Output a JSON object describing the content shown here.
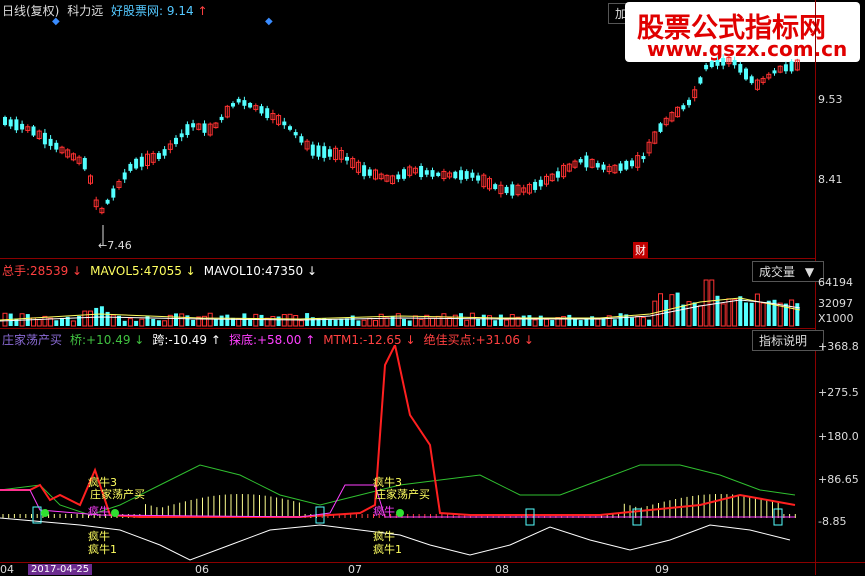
{
  "header": {
    "period": "日线(复权)",
    "stock": "科力远",
    "indicator": "好股票网:",
    "indicator_value": "9.14",
    "arrow_up": "↑",
    "add_button": "加自"
  },
  "watermark": {
    "line1": "股票公式指标网",
    "line2": "www.gszx.com.cn"
  },
  "price_panel": {
    "y_labels": [
      "9.53",
      "8.41"
    ],
    "low_marker": "←7.46",
    "cai_badge": "财"
  },
  "volume_panel": {
    "items": [
      {
        "label": "总手:",
        "value": "28539",
        "arrow": "↓",
        "color": "#ff4040"
      },
      {
        "label": "MAVOL5:",
        "value": "47055",
        "arrow": "↓",
        "color": "#ffff60"
      },
      {
        "label": "MAVOL10:",
        "value": "47350",
        "arrow": "↓",
        "color": "#ffffff"
      }
    ],
    "dropdown_label": "成交量",
    "y_labels": [
      "64194",
      "32097",
      "X1000"
    ]
  },
  "indicator_panel": {
    "items": [
      {
        "label": "庄家荡产买",
        "value": "",
        "arrow": "",
        "color": "#8b6bd6"
      },
      {
        "label": "桥:",
        "value": "+10.49",
        "arrow": "↓",
        "color": "#40c040"
      },
      {
        "label": "跨:",
        "value": "-10.49",
        "arrow": "↑",
        "color": "#ffffff"
      },
      {
        "label": "探底:",
        "value": "+58.00",
        "arrow": "↑",
        "color": "#ff40ff"
      },
      {
        "label": "MTM1:",
        "value": "-12.65",
        "arrow": "↓",
        "color": "#ff4040"
      },
      {
        "label": "绝佳买点:",
        "value": "+31.06",
        "arrow": "↓",
        "color": "#ff4040"
      }
    ],
    "help_button": "指标说明",
    "y_labels": [
      "+368.8",
      "+275.5",
      "+180.0",
      "+86.65",
      "-8.85"
    ],
    "annotations": {
      "niu3": "疯牛3",
      "zhuang": "庄家荡产买",
      "niu": "疯牛",
      "niu1": "疯牛1"
    }
  },
  "x_axis": {
    "start_date": "2017-04-25",
    "first_tick": "04",
    "ticks": [
      "06",
      "07",
      "08",
      "09"
    ]
  },
  "colors": {
    "up": "#ff3232",
    "down": "#54ffff",
    "grid_red": "#8b0000"
  }
}
